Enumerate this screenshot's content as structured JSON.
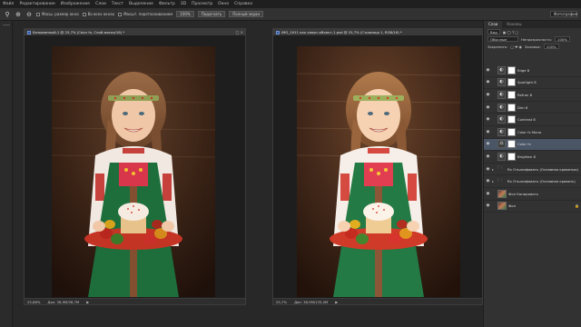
{
  "menu": {
    "items": [
      "Файл",
      "Редактирование",
      "Изображение",
      "Слои",
      "Текст",
      "Выделение",
      "Фильтр",
      "3D",
      "Просмотр",
      "Окно",
      "Справка"
    ]
  },
  "options": {
    "zoom_label": "Масш. размер окна",
    "all_windows_label": "Во всех окнах",
    "scrubby_label": "Масшт. перетаскиванием",
    "btn_100": "100%",
    "btn_fit": "Подогнать",
    "btn_fill": "Полный экран",
    "workspace": "Фотография"
  },
  "doc1": {
    "title": "Безымянный-1 @ 25,7% (Color fx, Слой-маска/16) *",
    "zoom": "25,88%",
    "doc_size": "Док: 36,9М/38,7М"
  },
  "doc2": {
    "title": "IMG_1911 как смарт-объект-1.psd @ 25,7% (Страница 1, RGB/16) *",
    "zoom": "25,7%",
    "doc_size": "Док: 36,9М/135,0М"
  },
  "panel": {
    "tabs": [
      "Слои",
      "Каналы"
    ],
    "filter_kind": "Вид",
    "blend_mode": "Обычные",
    "opacity_label": "Непрозрачность:",
    "opacity_value": "100%",
    "lock_label": "Закрепить:",
    "fill_label": "Заливка:",
    "fill_value": "100%"
  },
  "layers": [
    {
      "name": "Edge 8",
      "kind": "adj",
      "icon": "◐",
      "mask": "white",
      "selected": false
    },
    {
      "name": "Spotlight 8",
      "kind": "adj",
      "icon": "◐",
      "mask": "white",
      "selected": false
    },
    {
      "name": "Refran 8",
      "kind": "adj",
      "icon": "◐",
      "mask": "white",
      "selected": false
    },
    {
      "name": "Dim 8",
      "kind": "adj",
      "icon": "◐",
      "mask": "white",
      "selected": false
    },
    {
      "name": "Contrast 8",
      "kind": "adj",
      "icon": "◐",
      "mask": "white",
      "selected": false
    },
    {
      "name": "Color fx Mono",
      "kind": "adj",
      "icon": "◐",
      "mask": "white",
      "selected": false
    },
    {
      "name": "Color fx",
      "kind": "adj",
      "icon": "⚖",
      "mask": "white",
      "selected": true
    },
    {
      "name": "Brighten 8",
      "kind": "adj",
      "icon": "◐",
      "mask": "white",
      "selected": false
    },
    {
      "name": "Rx Отшлифовать (Основная кроватью)",
      "kind": "folder",
      "icon": "▸",
      "mask": "none",
      "selected": false
    },
    {
      "name": "Rx Отшлифовать (Основная кровать)",
      "kind": "folder",
      "icon": "▸",
      "mask": "none",
      "selected": false
    },
    {
      "name": "Фон Копировать",
      "kind": "photo",
      "icon": "",
      "mask": "none",
      "selected": false
    },
    {
      "name": "Фон",
      "kind": "photo",
      "icon": "",
      "mask": "none",
      "selected": false
    }
  ],
  "icons": {
    "zoom_tool": "magnifier-icon",
    "eye": "eye-icon",
    "folder": "folder-icon",
    "lock": "lock-icon"
  }
}
